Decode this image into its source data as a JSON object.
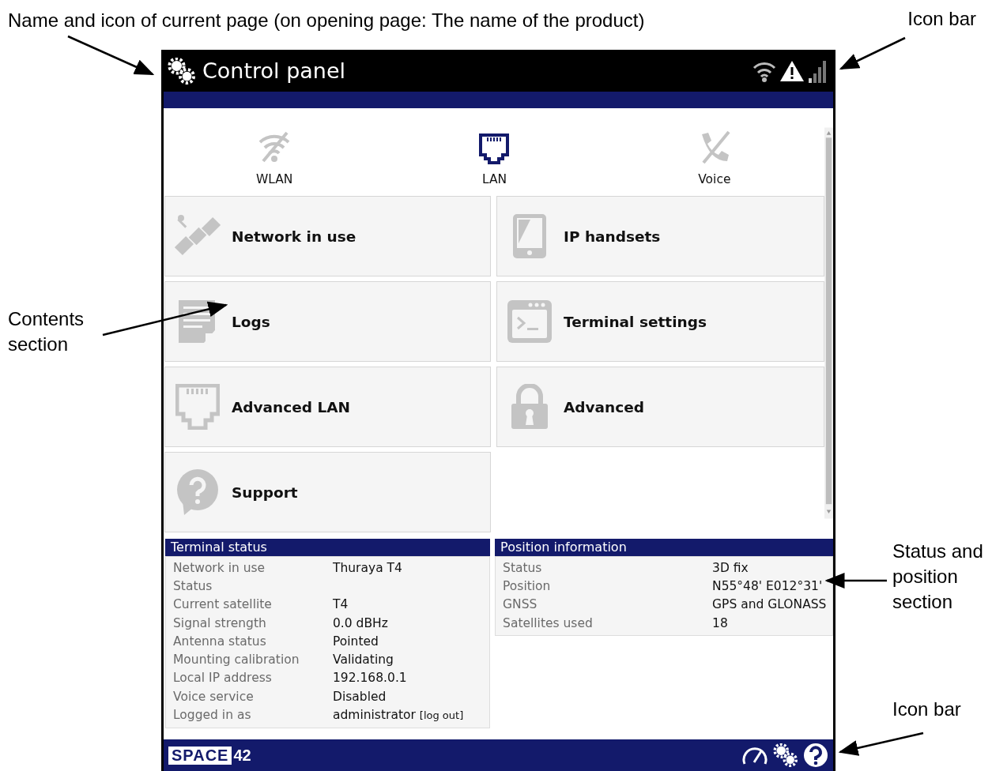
{
  "annotations": {
    "top_left": "Name and icon of current page (on opening page: The name of the product)",
    "top_right": "Icon bar",
    "left": "Contents section",
    "right_middle": "Status and position section",
    "bottom_right": "Icon bar"
  },
  "screen": {
    "title": "Control panel",
    "tabs": [
      {
        "label": "WLAN",
        "kind": "wlan",
        "active": false
      },
      {
        "label": "LAN",
        "kind": "lan",
        "active": true
      },
      {
        "label": "Voice",
        "kind": "voice",
        "active": false
      }
    ],
    "tiles": [
      {
        "label": "Network in use",
        "kind": "satellite"
      },
      {
        "label": "IP handsets",
        "kind": "handset"
      },
      {
        "label": "Logs",
        "kind": "logs"
      },
      {
        "label": "Terminal settings",
        "kind": "terminal"
      },
      {
        "label": "Advanced LAN",
        "kind": "lan"
      },
      {
        "label": "Advanced",
        "kind": "lock"
      },
      {
        "label": "Support",
        "kind": "support"
      }
    ],
    "terminal_status": {
      "title": "Terminal status",
      "rows": [
        {
          "label": "Network in use",
          "value": "Thuraya T4"
        },
        {
          "label": "Status"
        },
        {
          "label": "Current satellite",
          "value": "T4"
        },
        {
          "label": "Signal strength",
          "value": "0.0 dBHz"
        },
        {
          "label": "Antenna status",
          "value": "Pointed"
        },
        {
          "label": "Mounting calibration",
          "value": "Validating"
        },
        {
          "label": "Local IP address",
          "value": "192.168.0.1"
        },
        {
          "label": "Voice service",
          "value": "Disabled"
        },
        {
          "label": "Logged in as",
          "value": "administrator",
          "link": "[log out]"
        }
      ]
    },
    "position_information": {
      "title": "Position information",
      "rows": [
        {
          "label": "Status",
          "value": "3D fix"
        },
        {
          "label": "Position",
          "value": "N55°48' E012°31'"
        },
        {
          "label": "GNSS",
          "value": "GPS and GLONASS"
        },
        {
          "label": "Satellites used",
          "value": "18"
        }
      ]
    },
    "footer": {
      "logo_part_1": "SPACE",
      "logo_part_2": "42"
    }
  }
}
